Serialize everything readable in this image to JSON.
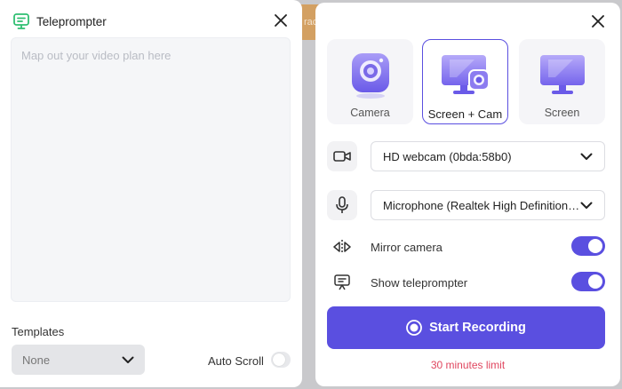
{
  "backdrop": {
    "text": "rac"
  },
  "teleprompter": {
    "title": "Teleprompter",
    "placeholder": "Map out your video plan here",
    "templates_label": "Templates",
    "template_value": "None",
    "auto_scroll_label": "Auto Scroll"
  },
  "recorder": {
    "modes": [
      {
        "label": "Camera",
        "selected": false
      },
      {
        "label": "Screen + Cam",
        "selected": true
      },
      {
        "label": "Screen",
        "selected": false
      }
    ],
    "camera_device": "HD webcam (0bda:58b0)",
    "microphone_device": "Microphone (Realtek High Definition Audio)",
    "mirror_label": "Mirror camera",
    "mirror_on": true,
    "show_tp_label": "Show teleprompter",
    "show_tp_on": true,
    "start_label": "Start Recording",
    "limit_text": "30 minutes limit"
  },
  "colors": {
    "accent": "#5a4fe0",
    "limit": "#e0465f",
    "teleprompter_icon": "#2fbf71"
  },
  "icons": [
    "teleprompter-icon",
    "close-icon",
    "chevron-down-icon",
    "video-camera-icon",
    "microphone-icon",
    "mirror-icon",
    "presentation-icon",
    "record-icon"
  ]
}
